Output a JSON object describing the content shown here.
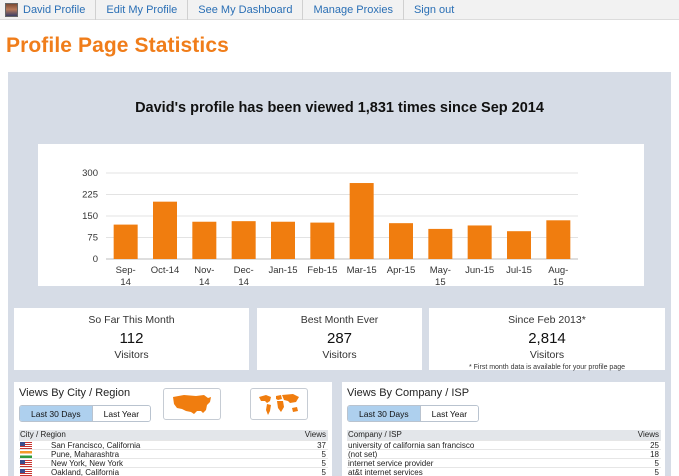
{
  "nav": {
    "items": [
      {
        "label": "David Profile"
      },
      {
        "label": "Edit My Profile"
      },
      {
        "label": "See My Dashboard"
      },
      {
        "label": "Manage Proxies"
      },
      {
        "label": "Sign out"
      }
    ]
  },
  "page_title": "Profile Page Statistics",
  "headline": "David's profile has been viewed 1,831 times since Sep 2014",
  "chart_data": {
    "type": "bar",
    "categories": [
      "Sep-14",
      "Oct-14",
      "Nov-14",
      "Dec-14",
      "Jan-15",
      "Feb-15",
      "Mar-15",
      "Apr-15",
      "May-15",
      "Jun-15",
      "Jul-15",
      "Aug-15"
    ],
    "category_lines": [
      [
        "Sep-",
        "14"
      ],
      [
        "Oct-14"
      ],
      [
        "Nov-",
        "14"
      ],
      [
        "Dec-",
        "14"
      ],
      [
        "Jan-15"
      ],
      [
        "Feb-15"
      ],
      [
        "Mar-15"
      ],
      [
        "Apr-15"
      ],
      [
        "May-",
        "15"
      ],
      [
        "Jun-15"
      ],
      [
        "Jul-15"
      ],
      [
        "Aug-",
        "15"
      ]
    ],
    "values": [
      120,
      200,
      130,
      132,
      130,
      127,
      265,
      125,
      105,
      117,
      97,
      135
    ],
    "yticks": [
      0,
      75,
      150,
      225,
      300
    ],
    "ylim": [
      0,
      300
    ],
    "grid": true,
    "bar_color": "#f07d0f",
    "title": "",
    "xlabel": "",
    "ylabel": ""
  },
  "stats": {
    "month": {
      "label": "So Far This Month",
      "value": "112",
      "unit": "Visitors"
    },
    "best": {
      "label": "Best Month Ever",
      "value": "287",
      "unit": "Visitors"
    },
    "since": {
      "label": "Since Feb 2013*",
      "value": "2,814",
      "unit": "Visitors",
      "note": "* First month data is available for your profile page"
    }
  },
  "city": {
    "title": "Views By City / Region",
    "buttons": {
      "last30": "Last 30 Days",
      "lastyear": "Last Year"
    },
    "col_place": "City / Region",
    "col_views": "Views",
    "rows": [
      {
        "flag": "us",
        "name": "San Francisco, California",
        "views": "37"
      },
      {
        "flag": "in",
        "name": "Pune, Maharashtra",
        "views": "5"
      },
      {
        "flag": "us",
        "name": "New York, New York",
        "views": "5"
      },
      {
        "flag": "us",
        "name": "Oakland, California",
        "views": "5"
      }
    ]
  },
  "company": {
    "title": "Views By Company / ISP",
    "buttons": {
      "last30": "Last 30 Days",
      "lastyear": "Last Year"
    },
    "col_place": "Company / ISP",
    "col_views": "Views",
    "rows": [
      {
        "name": "university of california san francisco",
        "views": "25"
      },
      {
        "name": "(not set)",
        "views": "18"
      },
      {
        "name": "internet service provider",
        "views": "5"
      },
      {
        "name": "at&t internet services",
        "views": "5"
      }
    ]
  },
  "colors": {
    "accent": "#f07d1a",
    "link": "#2a6fb5",
    "panel": "#d6dce6",
    "active_button": "#aed0ee"
  }
}
